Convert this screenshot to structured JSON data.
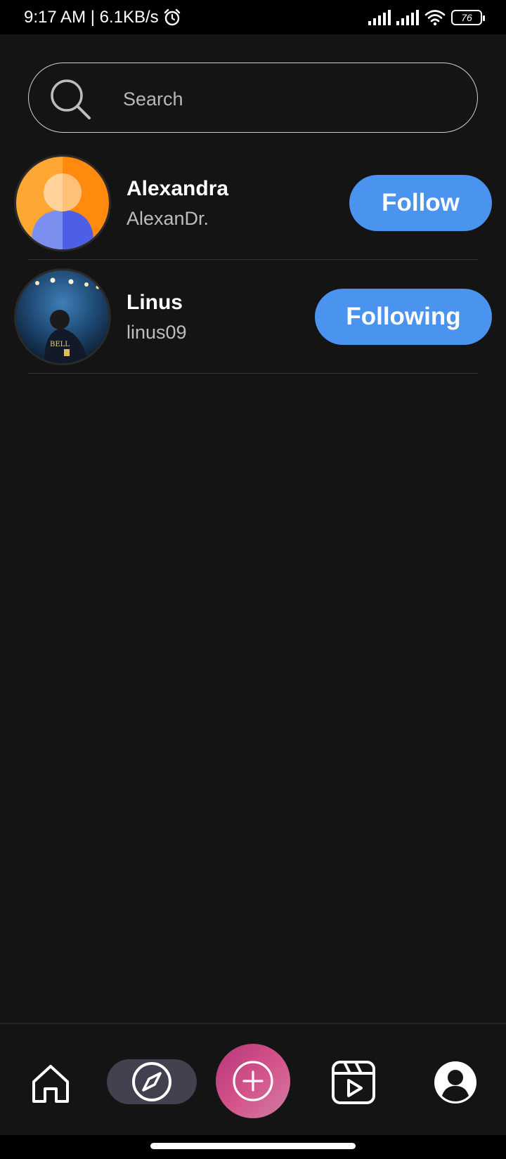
{
  "status_bar": {
    "time_speed": "9:17 AM | 6.1KB/s",
    "battery": "76"
  },
  "search": {
    "placeholder": "Search"
  },
  "users": [
    {
      "name": "Alexandra",
      "handle": "AlexanDr.",
      "button_label": "Follow",
      "avatar": "default-person-avatar"
    },
    {
      "name": "Linus",
      "handle": "linus09",
      "button_label": "Following",
      "avatar": "football-player-photo"
    }
  ],
  "bottom_nav": {
    "items": [
      "home-icon",
      "explore-compass-icon",
      "create-plus-icon",
      "reels-icon",
      "profile-icon"
    ],
    "active": "explore-compass-icon"
  },
  "colors": {
    "background": "#141414",
    "button": "#4a93ee",
    "create_gradient_start": "#b8367a",
    "create_gradient_end": "#cf7fa6",
    "explore_active_bg": "#43414f"
  }
}
